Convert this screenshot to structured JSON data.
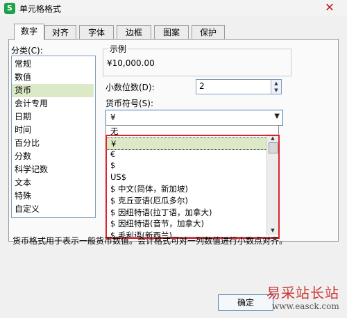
{
  "window": {
    "title": "单元格格式",
    "close_glyph": "✕",
    "app_icon_letter": "S"
  },
  "tabs": [
    {
      "label": "数字"
    },
    {
      "label": "对齐"
    },
    {
      "label": "字体"
    },
    {
      "label": "边框"
    },
    {
      "label": "图案"
    },
    {
      "label": "保护"
    }
  ],
  "category": {
    "label": "分类(C):",
    "items": [
      "常规",
      "数值",
      "货币",
      "会计专用",
      "日期",
      "时间",
      "百分比",
      "分数",
      "科学记数",
      "文本",
      "特殊",
      "自定义"
    ],
    "selected": "货币"
  },
  "sample": {
    "label": "示例",
    "value": "¥10,000.00"
  },
  "decimal": {
    "label": "小数位数(D):",
    "value": "2"
  },
  "currency": {
    "label": "货币符号(S):",
    "selected": "¥",
    "options": [
      "无",
      "¥",
      "€",
      "$",
      "US$",
      "$ 中文(简体，新加坡)",
      "$ 克丘亚语(厄瓜多尔)",
      "$ 因纽特语(拉丁语，加拿大)",
      "$ 因纽特语(音节，加拿大)",
      "$ 毛利语(新西兰)"
    ]
  },
  "description": "货币格式用于表示一般货币数值。会计格式可对一列数值进行小数点对齐。",
  "buttons": {
    "ok": "确定"
  },
  "watermark": {
    "line1": "易采站长站",
    "line2": "www.easck.com"
  },
  "colors": {
    "highlight_box": "#d9242b",
    "selection": "#dbe9c6"
  }
}
